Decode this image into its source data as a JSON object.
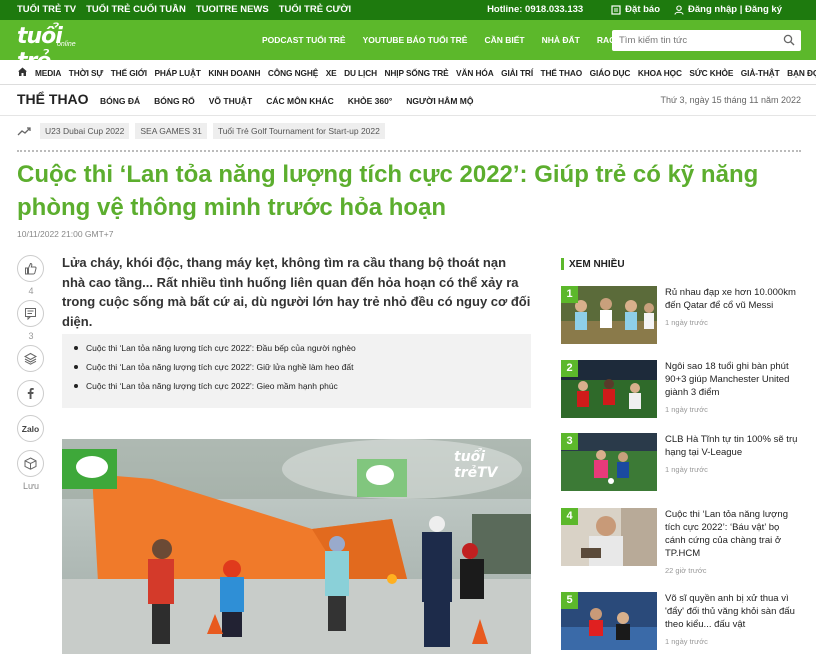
{
  "topbar": {
    "links": [
      "TUỔI TRẺ TV",
      "TUỔI TRẺ CUỐI TUẦN",
      "TUOITRE NEWS",
      "TUỔI TRẺ CƯỜI"
    ],
    "hotline": "Hotline: 0918.033.133",
    "subscribe": "Đặt báo",
    "login": "Đăng nhập | Đăng ký"
  },
  "header": {
    "logo_main": "tuổi trẻ",
    "logo_sub": "online",
    "links": [
      "PODCAST TUỔI TRẺ",
      "YOUTUBE BÁO TUỔI TRẺ",
      "CẦN BIẾT",
      "NHÀ ĐẤT",
      "RAO VẶT"
    ],
    "search_placeholder": "Tìm kiếm tin tức"
  },
  "nav": {
    "items": [
      "MEDIA",
      "THỜI SỰ",
      "THẾ GIỚI",
      "PHÁP LUẬT",
      "KINH DOANH",
      "CÔNG NGHỆ",
      "XE",
      "DU LỊCH",
      "NHỊP SỐNG TRẺ",
      "VĂN HÓA",
      "GIẢI TRÍ",
      "THỂ THAO",
      "GIÁO DỤC",
      "KHOA HỌC",
      "SỨC KHỎE",
      "GIẢ-THẬT",
      "BẠN ĐỌC"
    ]
  },
  "section": {
    "title": "THỂ THAO",
    "subs": [
      "BÓNG ĐÁ",
      "BÓNG RỔ",
      "VÕ THUẬT",
      "CÁC MÔN KHÁC",
      "KHỎE 360°",
      "NGƯỜI HÂM MỘ"
    ],
    "date": "Thứ 3, ngày 15 tháng 11 năm 2022"
  },
  "tags": [
    "U23 Dubai Cup 2022",
    "SEA GAMES 31",
    "Tuổi Trẻ Golf Tournament for Start-up 2022"
  ],
  "article": {
    "title": "Cuộc thi ‘Lan tỏa năng lượng tích cực 2022’: Giúp trẻ có kỹ năng phòng vệ thông minh trước hỏa hoạn",
    "date": "10/11/2022 21:00 GMT+7",
    "sapo": "Lửa cháy, khói độc, thang máy kẹt, không tìm ra cầu thang bộ thoát nạn nhà cao tầng... Rất nhiều tình huống liên quan đến hỏa hoạn có thể xảy ra trong cuộc sống mà bất cứ ai, dù người lớn hay trẻ nhỏ đều có nguy cơ đối diện.",
    "related": [
      "Cuộc thi ‘Lan tỏa năng lượng tích cực 2022’: Đầu bếp của người nghèo",
      "Cuộc thi ‘Lan tỏa năng lượng tích cực 2022’: Giữ lửa nghề làm heo đất",
      "Cuộc thi ‘Lan tỏa năng lượng tích cực 2022’: Gieo mầm hạnh phúc"
    ],
    "watermark": "tuổi trẻTV"
  },
  "share": {
    "like_count": "4",
    "comment_count": "3",
    "zalo": "Zalo",
    "save": "Lưu"
  },
  "sidebar": {
    "title": "XEM NHIỀU",
    "items": [
      {
        "num": "1",
        "title": "Rủ nhau đạp xe hơn 10.000km đến Qatar để cổ vũ Messi",
        "time": "1 ngày trước"
      },
      {
        "num": "2",
        "title": "Ngôi sao 18 tuổi ghi bàn phút 90+3 giúp Manchester United giành 3 điểm",
        "time": "1 ngày trước"
      },
      {
        "num": "3",
        "title": "CLB Hà Tĩnh tự tin 100% sẽ trụ hạng tại V-League",
        "time": "1 ngày trước"
      },
      {
        "num": "4",
        "title": "Cuộc thi ‘Lan tỏa năng lượng tích cực 2022’: ‘Báu vật’ bọ cánh cứng của chàng trai ở TP.HCM",
        "time": "22 giờ trước"
      },
      {
        "num": "5",
        "title": "Võ sĩ quyền anh bị xử thua vì 'đẩy' đối thủ văng khỏi sàn đấu theo kiểu... đấu vật",
        "time": "1 ngày trước"
      }
    ]
  },
  "colors": {
    "topbar": "#1e7a0e",
    "header": "#5cb82b",
    "title_green": "#5cae2e"
  }
}
